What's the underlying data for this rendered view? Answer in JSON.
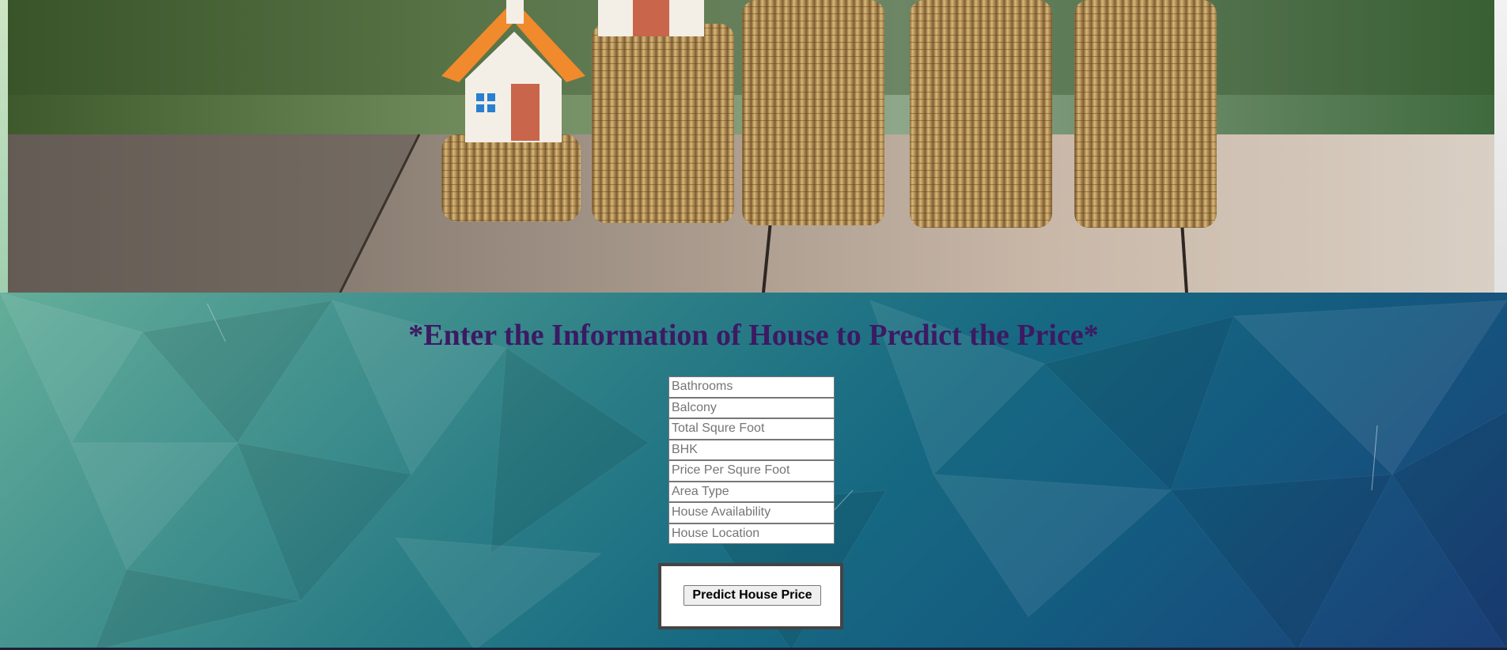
{
  "hero": {
    "image_name": "houses-on-coin-stacks-photo"
  },
  "heading": {
    "text": "*Enter the Information of House to Predict the Price*"
  },
  "form": {
    "fields": [
      {
        "name": "bathrooms",
        "placeholder": "Bathrooms",
        "value": ""
      },
      {
        "name": "balcony",
        "placeholder": "Balcony",
        "value": ""
      },
      {
        "name": "total_sqft",
        "placeholder": "Total Squre Foot",
        "value": ""
      },
      {
        "name": "bhk",
        "placeholder": "BHK",
        "value": ""
      },
      {
        "name": "price_per_sqft",
        "placeholder": "Price Per Squre Foot",
        "value": ""
      },
      {
        "name": "area_type",
        "placeholder": "Area Type",
        "value": ""
      },
      {
        "name": "availability",
        "placeholder": "House Availability",
        "value": ""
      },
      {
        "name": "location",
        "placeholder": "House Location",
        "value": ""
      }
    ],
    "submit_label": "Predict House Price"
  },
  "colors": {
    "heading": "#3c1a63",
    "background_start": "#7cc3a0",
    "background_end": "#1b3f78"
  }
}
